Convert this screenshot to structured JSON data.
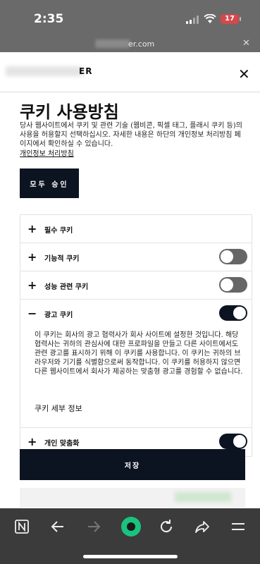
{
  "status_bar": {
    "time": "2:35",
    "battery": "17"
  },
  "url_bar": {
    "url": "er.com"
  },
  "modal": {
    "logo_text": "ER",
    "title": "쿠키 사용방침",
    "description": "당사 웹사이트에서 쿠키 및 관련 기술 (웹비콘, 픽셀 태그, 플래시 쿠키 등)의 사용을 허용할지 선택하십시오. 자세한 내용은 하단의 개인정보 처리방침 페이지에서 확인하실 수 있습니다.",
    "policy_link": "개인정보 처리방침",
    "accept_all": "모두 승인",
    "save": "저장"
  },
  "categories": [
    {
      "label": "필수 쿠키",
      "symbol": "+",
      "toggle": null
    },
    {
      "label": "기능적 쿠키",
      "symbol": "+",
      "toggle": "off"
    },
    {
      "label": "성능 관련 쿠키",
      "symbol": "+",
      "toggle": "off"
    },
    {
      "label": "광고 쿠키",
      "symbol": "−",
      "toggle": "on",
      "expanded_text": "이 쿠키는 회사의 광고 협력사가 회사 사이트에 설정한 것입니다. 해당 협력사는 귀하의 관심사에 대한 프로파일을 만들고 다른 사이트에서도 관련 광고를 표시하기 위해 이 쿠키를 사용합니다. 이 쿠키는 귀하의 브라우저와 기기를 식별함으로써 동작합니다. 이 쿠키를 허용하지 않으면 다른 웹사이트에서 회사가 제공하는 맞춤형 광고를 경험할 수 없습니다.",
      "detail_link": "쿠키 세부 정보"
    },
    {
      "label": "개인 맞춤화",
      "symbol": "+",
      "toggle": "on"
    }
  ],
  "toolbar": {
    "icons": [
      "notion-icon",
      "back-arrow-icon",
      "forward-arrow-icon",
      "home-record-icon",
      "reload-icon",
      "share-icon",
      "menu-icon"
    ]
  }
}
